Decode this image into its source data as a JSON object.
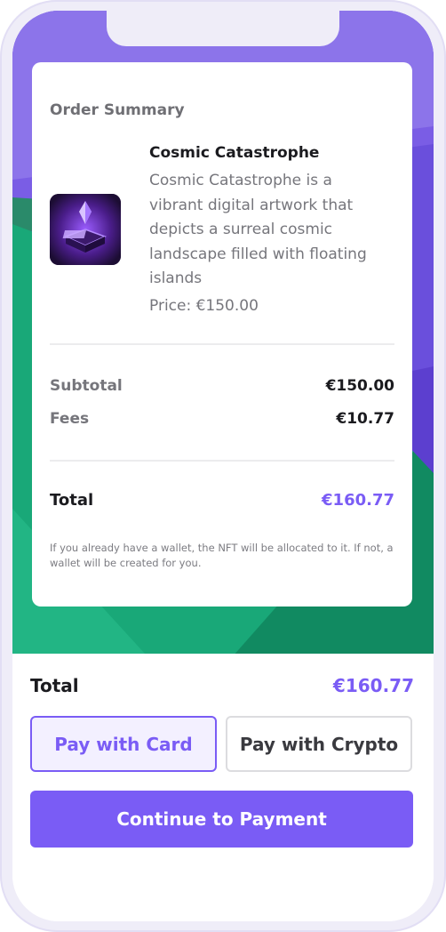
{
  "order": {
    "section_title": "Order Summary",
    "product": {
      "name": "Cosmic Catastrophe",
      "description": "Cosmic Catastrophe is a vibrant digital artwork that depicts a surreal cosmic landscape filled with floating islands",
      "price_label": "Price:",
      "price": "€150.00",
      "thumbnail_icon": "nft-artwork-thumbnail"
    },
    "subtotal_label": "Subtotal",
    "subtotal_value": "€150.00",
    "fees_label": "Fees",
    "fees_value": "€10.77",
    "total_label": "Total",
    "total_value": "€160.77",
    "note": "If you already have a wallet, the NFT will be allocated to it. If not, a wallet will be created for you."
  },
  "checkout": {
    "total_label": "Total",
    "total_value": "€160.77",
    "pay_card_label": "Pay with Card",
    "pay_crypto_label": "Pay with Crypto",
    "selected_method": "Pay with Card",
    "continue_label": "Continue to Payment"
  },
  "colors": {
    "accent": "#7a5cf5",
    "background_purple": "#7d62e6",
    "background_green": "#18a978"
  }
}
